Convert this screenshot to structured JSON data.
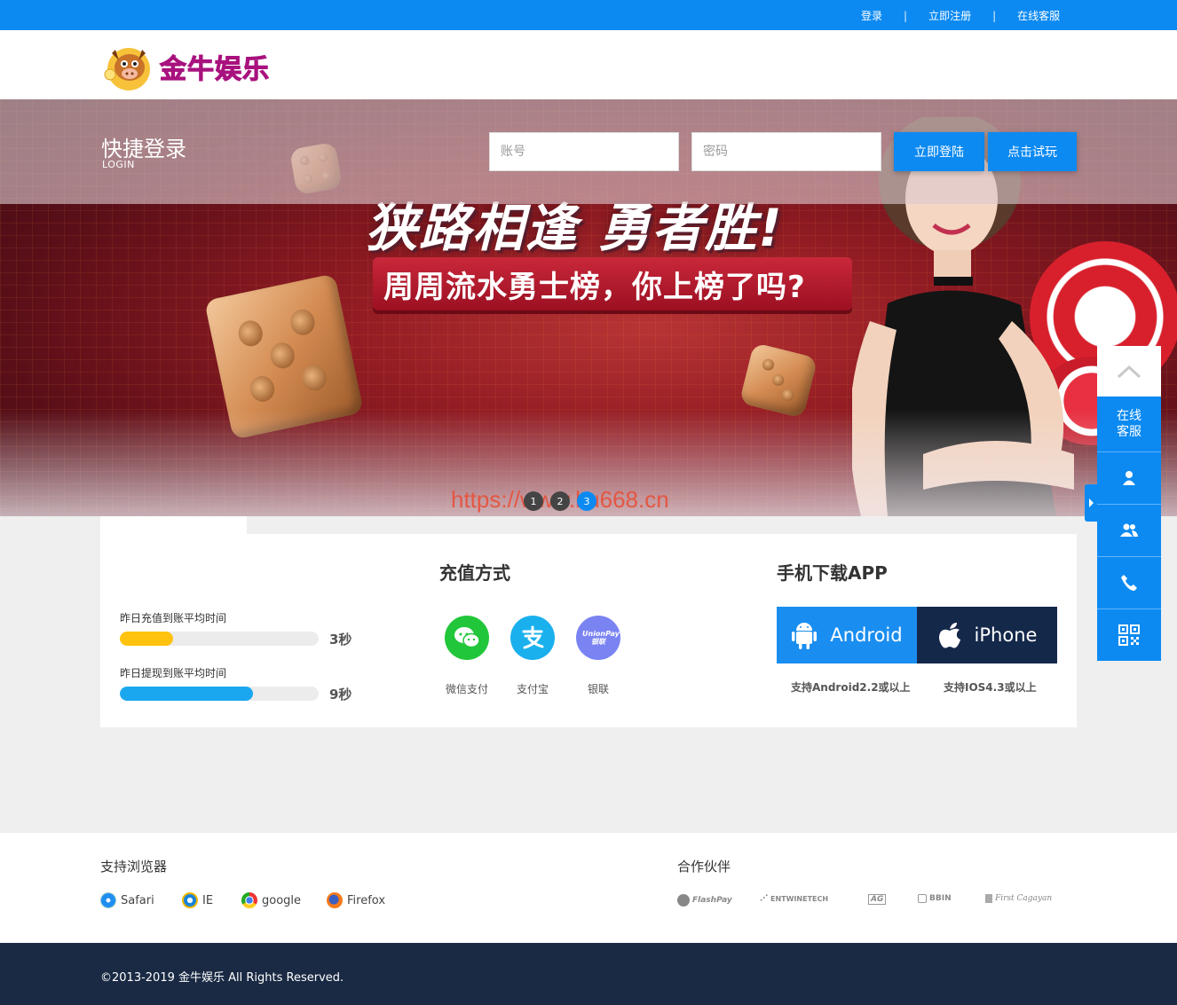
{
  "topbar": {
    "links": [
      "登录",
      "立即注册",
      "在线客服"
    ],
    "separator": "|"
  },
  "logo": {
    "text": "金牛娱乐"
  },
  "login": {
    "title": "快捷登录",
    "subtitle": "LOGIN",
    "account_placeholder": "账号",
    "password_placeholder": "密码",
    "login_button": "立即登陆",
    "trial_button": "点击试玩"
  },
  "banner": {
    "headline": "狭路相逢 勇者胜!",
    "subline": "周周流水勇士榜，你上榜了吗?",
    "watermark": "https://www.ku668.cn",
    "pages": [
      "1",
      "2",
      "3"
    ],
    "active_page": 3
  },
  "stats": [
    {
      "label": "昨日充值到账平均时间",
      "value": "3秒",
      "fill": 0.27,
      "color": "#ffc20e"
    },
    {
      "label": "昨日提现到账平均时间",
      "value": "9秒",
      "fill": 0.67,
      "color": "#1aa7f0"
    }
  ],
  "recharge": {
    "title": "充值方式",
    "methods": [
      {
        "label": "微信支付",
        "icon": "wechat-icon",
        "color": "#22c63a"
      },
      {
        "label": "支付宝",
        "icon": "alipay-icon",
        "color": "#1ab0ee"
      },
      {
        "label": "银联",
        "icon": "unionpay-icon",
        "color": "#7a83f2",
        "badge_text": "UnionPay 银联"
      }
    ]
  },
  "app": {
    "title": "手机下载APP",
    "android_label": "Android",
    "iphone_label": "iPhone",
    "android_note": "支持Android2.2或以上",
    "iphone_note": "支持IOS4.3或以上",
    "android_color": "#1a8ef0",
    "iphone_color": "#14284a"
  },
  "side": {
    "service_label_1": "在线",
    "service_label_2": "客服"
  },
  "footer": {
    "browsers_title": "支持浏览器",
    "browsers": [
      "Safari",
      "IE",
      "google",
      "Firefox"
    ],
    "partners_title": "合作伙伴",
    "partners": [
      "FlashPay",
      "ENTWINETECH",
      "AG",
      "BBIN",
      "First Cagayan"
    ],
    "copyright": "©2013-2019 金牛娱乐 All Rights Reserved."
  }
}
